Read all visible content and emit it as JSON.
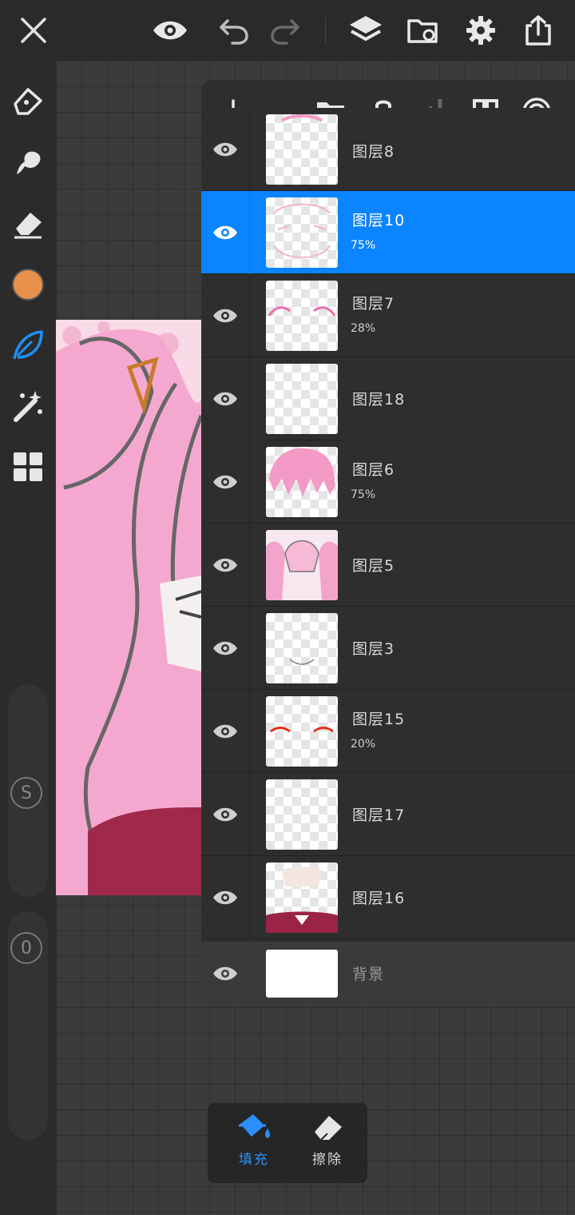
{
  "toolbar": {
    "close": "close-icon",
    "preview": "eye-icon",
    "undo": "undo-icon",
    "redo": "redo-icon",
    "layers": "layers-icon",
    "import": "folder-import-icon",
    "settings": "gear-icon",
    "export": "share-icon"
  },
  "tools": {
    "pen": "pen-icon",
    "smudge": "smudge-icon",
    "eraser": "eraser-icon",
    "color": "#e8914a",
    "leaf_brush": "leaf-brush-icon",
    "magic": "magic-wand-icon",
    "grid": "grid-icon",
    "size_label": "S",
    "opacity_label": "0"
  },
  "layers_panel": {
    "header_icons": [
      "plus-icon",
      "folder-icon",
      "lock-icon",
      "merge-down-icon",
      "checker-icon",
      "circles-icon"
    ],
    "layers": [
      {
        "name": "图层8",
        "opacity": ""
      },
      {
        "name": "图层10",
        "opacity": "75%"
      },
      {
        "name": "图层7",
        "opacity": "28%"
      },
      {
        "name": "图层18",
        "opacity": ""
      },
      {
        "name": "图层6",
        "opacity": "75%"
      },
      {
        "name": "图层5",
        "opacity": ""
      },
      {
        "name": "图层3",
        "opacity": ""
      },
      {
        "name": "图层15",
        "opacity": "20%"
      },
      {
        "name": "图层17",
        "opacity": ""
      },
      {
        "name": "图层16",
        "opacity": ""
      }
    ],
    "background": {
      "name": "背景"
    },
    "selected_color": "#0a84ff"
  },
  "fill_popup": {
    "fill_label": "填充",
    "erase_label": "擦除",
    "active_color": "#2b8fff"
  }
}
